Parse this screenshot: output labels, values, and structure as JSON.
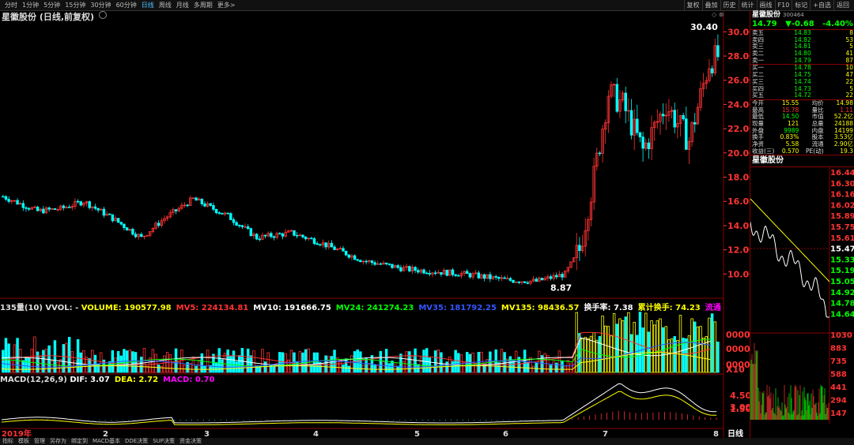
{
  "toolbar": {
    "left": [
      "分时",
      "1分钟",
      "5分钟",
      "15分钟",
      "30分钟",
      "60分钟",
      "日线",
      "周线",
      "月线",
      "多周期",
      "更多>"
    ],
    "active_index": 6,
    "right": [
      "复权",
      "叠加",
      "历史",
      "统计",
      "画线",
      "F10",
      "标记",
      "+自选",
      "返回"
    ]
  },
  "chart_title": "星徽股份 (日线,前复权)",
  "price_axis": {
    "min": 8,
    "max": 31,
    "labels": [
      "30.00",
      "28.00",
      "26.00",
      "24.00",
      "22.00",
      "20.00",
      "18.00",
      "16.00",
      "14.00",
      "12.00",
      "10.00"
    ],
    "values": [
      30,
      28,
      26,
      24,
      22,
      20,
      18,
      16,
      14,
      12,
      10
    ]
  },
  "annotations": {
    "high": "30.40",
    "low": "8.87",
    "high_value": 30.4,
    "low_value": 8.87
  },
  "volume_line": {
    "prefix": "135量(10) VVOL: -",
    "items": [
      {
        "label": "VOLUME: 190577.98",
        "color": "#ffff00"
      },
      {
        "label": "MV5: 224134.81",
        "color": "#ff3333"
      },
      {
        "label": "MV10: 191666.75",
        "color": "#ffffff"
      },
      {
        "label": "MV24: 241274.23",
        "color": "#00ff00"
      },
      {
        "label": "MV35: 181792.25",
        "color": "#3355ff"
      },
      {
        "label": "MV135: 98436.57",
        "color": "#ffff00"
      },
      {
        "label": "换手率: 7.38",
        "color": "#ffffff"
      },
      {
        "label": "累计换手: 74.23",
        "color": "#ffff00"
      },
      {
        "label": "流通",
        "color": "#ff00ff"
      }
    ]
  },
  "volume_axis": {
    "labels": [
      "0000",
      "0000",
      "0000",
      "X10"
    ]
  },
  "macd_line": {
    "prefix": "MACD(12,26,9)",
    "items": [
      {
        "label": "DIF: 3.07",
        "color": "#ffffff"
      },
      {
        "label": "DEA: 2.72",
        "color": "#ffff00"
      },
      {
        "label": "MACD: 0.70",
        "color": "#ff00ff"
      }
    ]
  },
  "macd_axis": {
    "labels": [
      "4.50",
      "3.00",
      "1.50"
    ]
  },
  "x_axis": {
    "labels": [
      "2019年",
      "2",
      "3",
      "4",
      "5",
      "6",
      "7",
      "8"
    ],
    "period": "日线"
  },
  "bottombar": [
    "指标",
    "模板",
    "管理",
    "另存为",
    "绑定到",
    "MACD基本",
    "DDE决策",
    "SUP决策",
    "资金决策"
  ],
  "quote": {
    "name": "星徽股份",
    "code": "300464",
    "price": "14.79",
    "change": "▼-0.68",
    "pct": "-4.40%",
    "asks": [
      {
        "label": "卖五",
        "price": "14.83",
        "vol": "8"
      },
      {
        "label": "卖四",
        "price": "14.82",
        "vol": "53"
      },
      {
        "label": "卖三",
        "price": "14.81",
        "vol": "5"
      },
      {
        "label": "卖二",
        "price": "14.80",
        "vol": "41"
      },
      {
        "label": "卖一",
        "price": "14.79",
        "vol": "87"
      }
    ],
    "bids": [
      {
        "label": "买一",
        "price": "14.78",
        "vol": "10"
      },
      {
        "label": "买二",
        "price": "14.75",
        "vol": "47"
      },
      {
        "label": "买三",
        "price": "14.74",
        "vol": "22"
      },
      {
        "label": "买四",
        "price": "14.73",
        "vol": "5"
      },
      {
        "label": "买五",
        "price": "14.72",
        "vol": "22"
      }
    ],
    "stats": [
      {
        "l1": "今开",
        "v1": "15.55",
        "l2": "均价",
        "v2": "14.98"
      },
      {
        "l1": "最高",
        "v1": "15.78",
        "l2": "量比",
        "v2": "1.11"
      },
      {
        "l1": "最低",
        "v1": "14.50",
        "l2": "市值",
        "v2": "52.2亿"
      },
      {
        "l1": "现量",
        "v1": "121",
        "l2": "总量",
        "v2": "24188"
      },
      {
        "l1": "外盘",
        "v1": "9989",
        "l2": "内盘",
        "v2": "14199"
      },
      {
        "l1": "换手",
        "v1": "0.83%",
        "l2": "股本",
        "v2": "3.53亿"
      },
      {
        "l1": "净资",
        "v1": "5.58",
        "l2": "流通",
        "v2": "2.90亿"
      },
      {
        "l1": "收益(三)",
        "v1": "0.570",
        "l2": "PE(动)",
        "v2": "19.3"
      }
    ]
  },
  "mini": {
    "title": "星徽股份",
    "price_labels": [
      "16.44",
      "16.30",
      "16.16",
      "16.02",
      "15.89",
      "15.75",
      "15.61",
      "15.47",
      "15.33",
      "15.19",
      "15.05",
      "14.92",
      "14.78",
      "14.64"
    ],
    "vol_labels": [
      "1030",
      "883",
      "735",
      "588",
      "441",
      "294",
      "147"
    ]
  },
  "colors": {
    "up": "#ff3333",
    "down": "#00ffff",
    "axis_red": "#ff3333",
    "border": "#880000"
  }
}
